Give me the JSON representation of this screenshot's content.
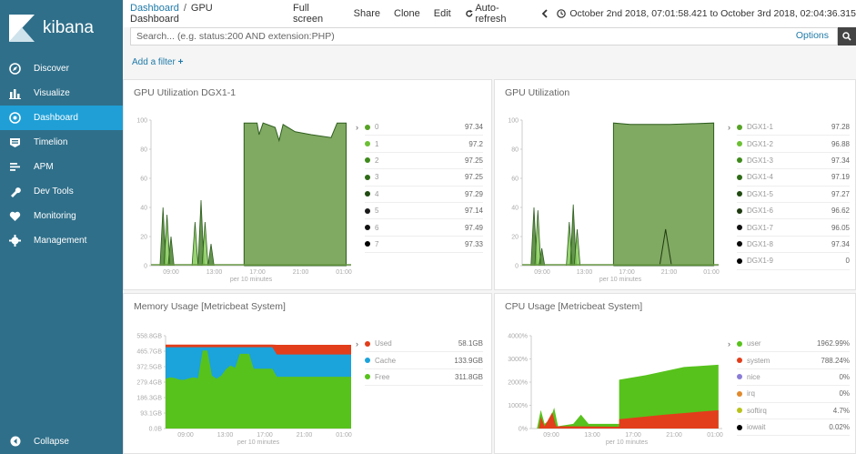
{
  "sidebar": {
    "brand": "kibana",
    "items": [
      {
        "label": "Discover",
        "icon": "compass-icon",
        "active": false
      },
      {
        "label": "Visualize",
        "icon": "bar-chart-icon",
        "active": false
      },
      {
        "label": "Dashboard",
        "icon": "dashboard-icon",
        "active": true
      },
      {
        "label": "Timelion",
        "icon": "timelion-icon",
        "active": false
      },
      {
        "label": "APM",
        "icon": "apm-icon",
        "active": false
      },
      {
        "label": "Dev Tools",
        "icon": "wrench-icon",
        "active": false
      },
      {
        "label": "Monitoring",
        "icon": "heartbeat-icon",
        "active": false
      },
      {
        "label": "Management",
        "icon": "gear-icon",
        "active": false
      }
    ],
    "collapse_label": "Collapse"
  },
  "topbar": {
    "breadcrumb_root": "Dashboard",
    "breadcrumb_separator": "/",
    "breadcrumb_current": "GPU Dashboard",
    "menu": [
      "Full screen",
      "Share",
      "Clone",
      "Edit"
    ],
    "auto_refresh": "Auto-refresh",
    "time_range": "October 2nd 2018, 07:01:58.421 to October 3rd 2018, 02:04:36.315"
  },
  "search": {
    "placeholder": "Search... (e.g. status:200 AND extension:PHP)",
    "options_label": "Options"
  },
  "filter": {
    "add_label": "Add a filter"
  },
  "colors": {
    "sidebar_bg": "#2f6f8a",
    "active_bg": "#1f9fd6",
    "green_dark": "#2e5e1e",
    "green_fill": "#6a9a46",
    "green_bright": "#57c21c",
    "red": "#e23e1b",
    "blue": "#1ba3dc"
  },
  "panels": [
    {
      "title": "GPU Utilization DGX1-1",
      "legend": [
        {
          "name": "0",
          "value": "97.34",
          "color": "#57a225"
        },
        {
          "name": "1",
          "value": "97.2",
          "color": "#6cbf34"
        },
        {
          "name": "2",
          "value": "97.25",
          "color": "#3f8a1c"
        },
        {
          "name": "3",
          "value": "97.25",
          "color": "#2e6b16"
        },
        {
          "name": "4",
          "value": "97.29",
          "color": "#1f4a10"
        },
        {
          "name": "5",
          "value": "97.14",
          "color": "#1a1a1a"
        },
        {
          "name": "6",
          "value": "97.49",
          "color": "#111111"
        },
        {
          "name": "7",
          "value": "97.33",
          "color": "#000000"
        }
      ]
    },
    {
      "title": "GPU Utilization",
      "legend": [
        {
          "name": "DGX1-1",
          "value": "97.28",
          "color": "#57a225"
        },
        {
          "name": "DGX1-2",
          "value": "96.88",
          "color": "#6cbf34"
        },
        {
          "name": "DGX1-3",
          "value": "97.34",
          "color": "#3f8a1c"
        },
        {
          "name": "DGX1-4",
          "value": "97.19",
          "color": "#2e6b16"
        },
        {
          "name": "DGX1-5",
          "value": "97.27",
          "color": "#1f4a10"
        },
        {
          "name": "DGX1-6",
          "value": "96.62",
          "color": "#1f3a10"
        },
        {
          "name": "DGX1-7",
          "value": "96.05",
          "color": "#111111"
        },
        {
          "name": "DGX1-8",
          "value": "97.34",
          "color": "#0a0a0a"
        },
        {
          "name": "DGX1-9",
          "value": "0",
          "color": "#000000"
        }
      ]
    },
    {
      "title": "Memory Usage [Metricbeat System]",
      "legend": [
        {
          "name": "Used",
          "value": "58.1GB",
          "color": "#e23e1b"
        },
        {
          "name": "Cache",
          "value": "133.9GB",
          "color": "#1ba3dc"
        },
        {
          "name": "Free",
          "value": "311.8GB",
          "color": "#57c21c"
        }
      ]
    },
    {
      "title": "CPU Usage [Metricbeat System]",
      "legend": [
        {
          "name": "user",
          "value": "1962.99%",
          "color": "#57c21c"
        },
        {
          "name": "system",
          "value": "788.24%",
          "color": "#e23e1b"
        },
        {
          "name": "nice",
          "value": "0%",
          "color": "#8a7cd6"
        },
        {
          "name": "irq",
          "value": "0%",
          "color": "#e08a2e"
        },
        {
          "name": "softirq",
          "value": "4.7%",
          "color": "#b8c21c"
        },
        {
          "name": "iowait",
          "value": "0.02%",
          "color": "#000000"
        }
      ]
    }
  ],
  "charts": {
    "gpu_ticks_y": [
      "100",
      "80",
      "60",
      "40",
      "20",
      "0"
    ],
    "mem_ticks_y": [
      "558.8GB",
      "465.7GB",
      "372.5GB",
      "279.4GB",
      "186.3GB",
      "93.1GB",
      "0.0B"
    ],
    "cpu_ticks_y": [
      "4000%",
      "3000%",
      "2000%",
      "1000%",
      "0%"
    ],
    "ticks_x": [
      "09:00",
      "13:00",
      "17:00",
      "21:00",
      "01:00"
    ],
    "x_axis_label": "per 10 minutes"
  }
}
